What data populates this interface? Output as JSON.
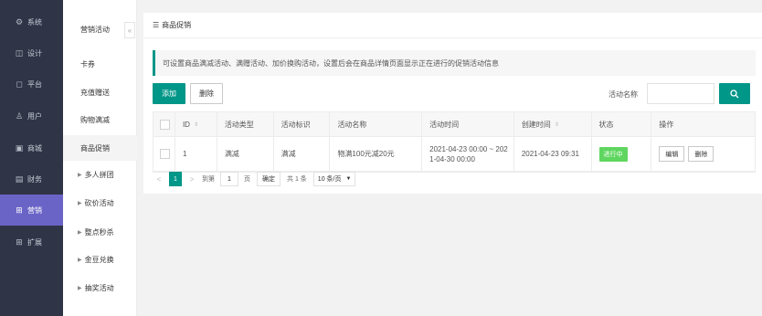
{
  "nav": {
    "items": [
      {
        "label": "系统",
        "icon": "gear-icon",
        "glyph": "⚙"
      },
      {
        "label": "设计",
        "icon": "design-icon",
        "glyph": "◫"
      },
      {
        "label": "平台",
        "icon": "platform-icon",
        "glyph": "◻"
      },
      {
        "label": "用户",
        "icon": "user-icon",
        "glyph": "♙"
      },
      {
        "label": "商城",
        "icon": "mall-icon",
        "glyph": "▣"
      },
      {
        "label": "财务",
        "icon": "finance-icon",
        "glyph": "▤"
      },
      {
        "label": "营销",
        "icon": "marketing-icon",
        "glyph": "⊞"
      },
      {
        "label": "扩展",
        "icon": "extend-icon",
        "glyph": "⊞"
      }
    ],
    "active_index": 6
  },
  "subnav": {
    "items": [
      {
        "label": "营销活动"
      },
      {
        "label": "卡券"
      },
      {
        "label": "充值赠送"
      },
      {
        "label": "购物满减"
      },
      {
        "label": "商品促销"
      },
      {
        "label": "多人拼团"
      },
      {
        "label": "砍价活动"
      },
      {
        "label": "整点秒杀"
      },
      {
        "label": "金豆兑换"
      },
      {
        "label": "抽奖活动"
      }
    ],
    "collapse_glyph": "«"
  },
  "page": {
    "title": "商品促销",
    "notice": "可设置商品满减活动、满赠活动、加价换购活动，设置后会在商品详情页面显示正在进行的促销活动信息",
    "add_label": "添加",
    "delete_label": "删除",
    "search_label": "活动名称",
    "search_value": ""
  },
  "table": {
    "headers": [
      "",
      "ID",
      "活动类型",
      "活动标识",
      "活动名称",
      "活动时间",
      "创建时间",
      "状态",
      "操作"
    ],
    "rows": [
      {
        "id": "1",
        "type": "满减",
        "tag": "满减",
        "name": "物满100元减20元",
        "time_line1": "2021-04-23 00:00 ~ 202",
        "time_line2": "1-04-30 00:00",
        "created": "2021-04-23 09:31",
        "status": "进行中",
        "edit_label": "编辑",
        "delete_label": "删除"
      }
    ]
  },
  "pager": {
    "prev": "<",
    "current": "1",
    "next": ">",
    "goto_label": "到第",
    "goto_value": "1",
    "page_unit": "页",
    "confirm_label": "确定",
    "total": "共 1 条",
    "page_size": "10 条/页"
  },
  "colors": {
    "nav_bg": "#2f3447",
    "nav_active": "#6b64c7",
    "primary": "#009688",
    "status_green": "#5fd65f"
  }
}
